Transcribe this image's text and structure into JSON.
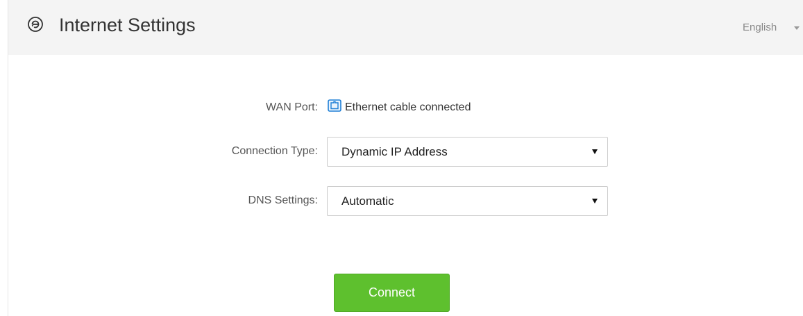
{
  "header": {
    "title": "Internet Settings",
    "icon": "globe-settings-icon",
    "language_label": "English"
  },
  "form": {
    "wan_port": {
      "label": "WAN Port:",
      "icon": "ethernet-port-icon",
      "status": "Ethernet cable connected"
    },
    "connection_type": {
      "label": "Connection Type:",
      "value": "Dynamic IP Address"
    },
    "dns_settings": {
      "label": "DNS Settings:",
      "value": "Automatic"
    }
  },
  "actions": {
    "connect_label": "Connect"
  },
  "colors": {
    "header_bg": "#f4f4f4",
    "button_green": "#5ec02e",
    "icon_blue": "#1e7fd6"
  }
}
